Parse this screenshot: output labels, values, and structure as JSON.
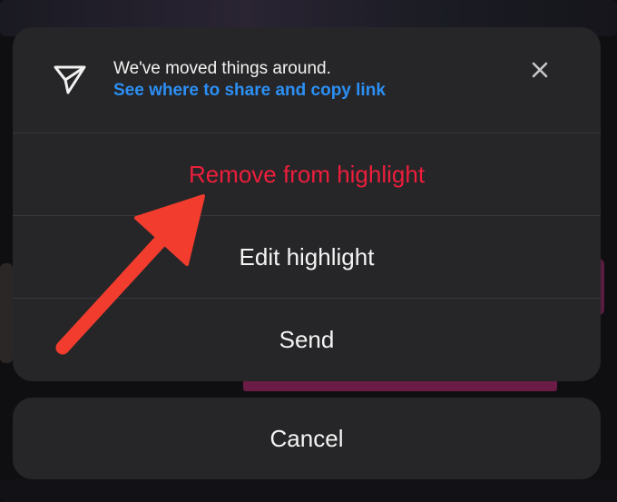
{
  "notice": {
    "title": "We've moved things around.",
    "link": "See where to share and copy link",
    "icon": "send-icon",
    "close_icon": "close-icon"
  },
  "actions": [
    {
      "label": "Remove from highlight",
      "color": "#ee1e3c"
    },
    {
      "label": "Edit highlight",
      "color": "#f4f4f4"
    },
    {
      "label": "Send",
      "color": "#f4f4f4"
    }
  ],
  "cancel": {
    "label": "Cancel"
  },
  "colors": {
    "sheet_background": "#262628",
    "link": "#2b8ff5",
    "destructive": "#ee1e3c",
    "annotation_arrow": "#f23c2e"
  }
}
